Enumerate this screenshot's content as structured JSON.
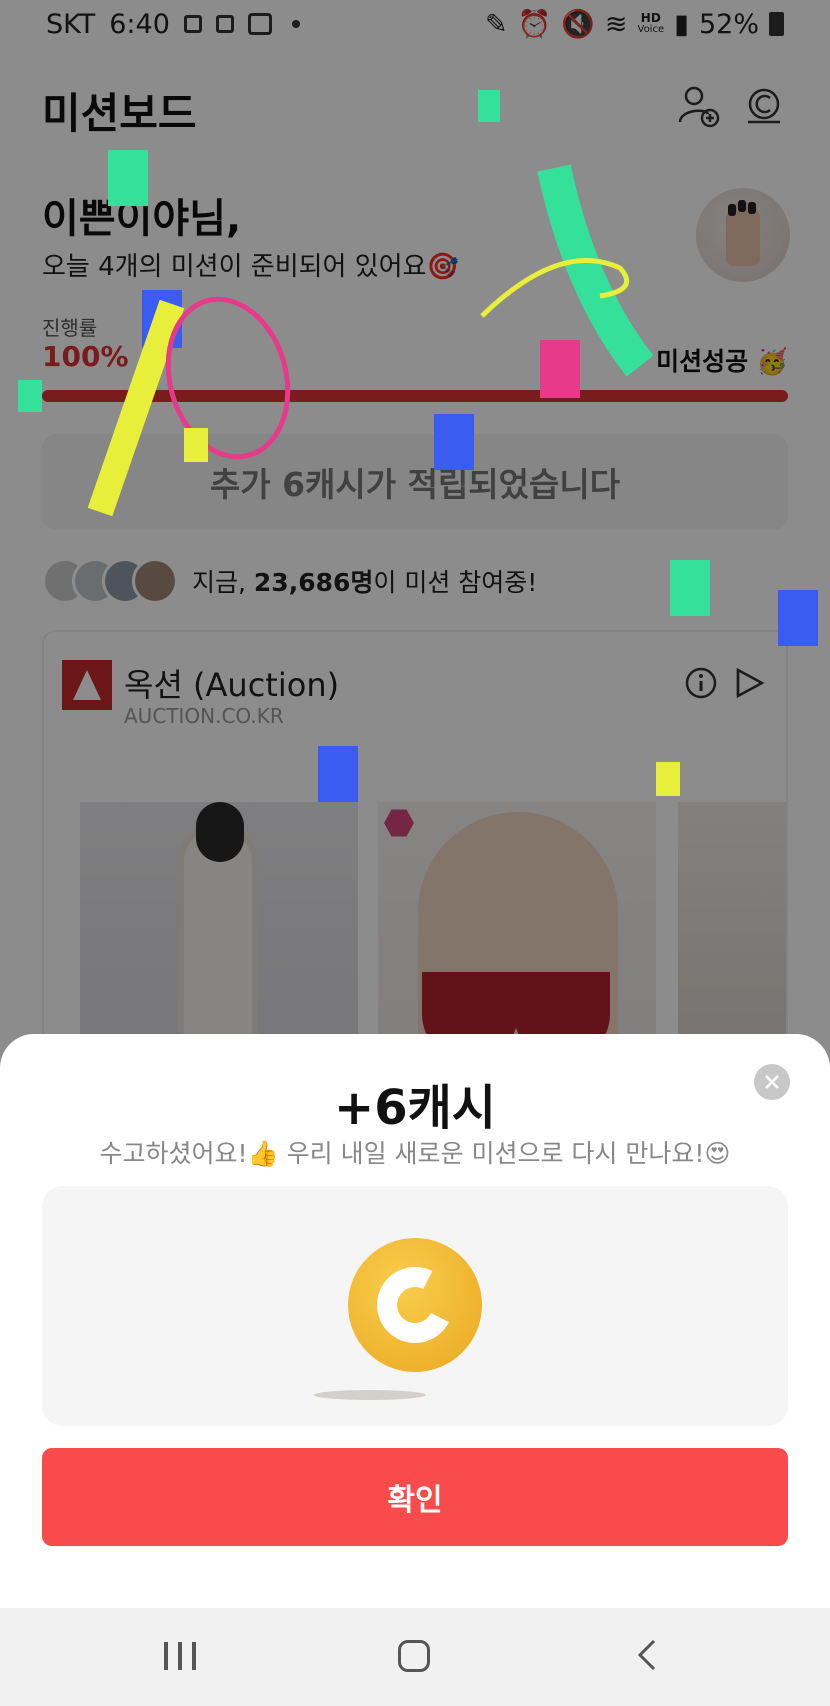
{
  "status_bar": {
    "carrier": "SKT",
    "time": "6:40",
    "battery": "52%",
    "hd_label": "HD",
    "voice_label": "Voice"
  },
  "header": {
    "title": "미션보드",
    "icons": [
      "add-friend-icon",
      "cash-icon"
    ]
  },
  "greeting": {
    "name_line": "이쁜이야님,",
    "subtitle": "오늘 4개의 미션이 준비되어 있어요🎯"
  },
  "progress": {
    "label": "진행률",
    "value_text": "100%",
    "value": 1.0,
    "success_text": "미션성공 🥳"
  },
  "cash_notice": "추가 6캐시가 적립되었습니다",
  "participants": {
    "prefix": "지금, ",
    "count": "23,686명",
    "suffix": "이 미션 참여중!"
  },
  "ad": {
    "name": "옥션 (Auction)",
    "domain": "AUCTION.CO.KR"
  },
  "sheet": {
    "title": "+6캐시",
    "subtitle": "수고하셨어요!👍 우리 내일 새로운 미션으로 다시 만나요!😍",
    "confirm_label": "확인"
  },
  "colors": {
    "accent": "#fa4b4c",
    "progress": "#d33333",
    "coin": "#f2b632"
  }
}
